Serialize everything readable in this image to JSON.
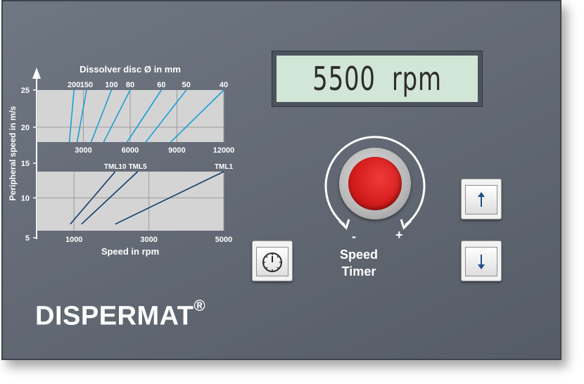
{
  "display": {
    "value": "5500",
    "unit": "rpm"
  },
  "knob": {
    "label_line1": "Speed",
    "label_line2": "Timer",
    "minus": "-",
    "plus": "+"
  },
  "buttons": {
    "timer_icon": "stopwatch-icon",
    "up_icon": "arrow-up-icon",
    "down_icon": "arrow-down-icon"
  },
  "brand": {
    "name": "DISPERMAT",
    "mark": "®"
  },
  "colors": {
    "panel": "#656c77",
    "lcd": "#d1e6d6",
    "knob_red": "#d51d1d",
    "chart_bg": "#d4d4d4",
    "upper_lines": "#1a9fd6",
    "lower_lines": "#123a68"
  },
  "chart_data": [
    {
      "type": "line",
      "title": "Dissolver disc Ø in mm",
      "ylabel": "Peripheral speed in m/s",
      "xlabel": "",
      "ylim": [
        18,
        25
      ],
      "xlim": [
        0,
        12000
      ],
      "x_ticks": [
        "3000",
        "6000",
        "9000",
        "12000"
      ],
      "y_ticks": [
        "25",
        "20",
        "15",
        "10",
        "5"
      ],
      "grid": true,
      "series": [
        {
          "name": "200",
          "x": [
            2100,
            2400
          ],
          "y": [
            18,
            25
          ]
        },
        {
          "name": "150",
          "x": [
            2600,
            3200
          ],
          "y": [
            18,
            25
          ]
        },
        {
          "name": "100",
          "x": [
            3500,
            4800
          ],
          "y": [
            18,
            25
          ]
        },
        {
          "name": "80",
          "x": [
            4300,
            6000
          ],
          "y": [
            18,
            25
          ]
        },
        {
          "name": "60",
          "x": [
            5800,
            8000
          ],
          "y": [
            18,
            25
          ]
        },
        {
          "name": "50",
          "x": [
            7000,
            9600
          ],
          "y": [
            18,
            25
          ]
        },
        {
          "name": "40",
          "x": [
            8600,
            12000
          ],
          "y": [
            18,
            25
          ]
        }
      ]
    },
    {
      "type": "line",
      "title": "",
      "xlabel": "Speed in rpm",
      "ylim": [
        5,
        14
      ],
      "xlim": [
        0,
        5000
      ],
      "x_ticks": [
        "1000",
        "3000",
        "5000"
      ],
      "grid": true,
      "series": [
        {
          "name": "TML10",
          "x": [
            900,
            2100
          ],
          "y": [
            6,
            14
          ]
        },
        {
          "name": "TML5",
          "x": [
            1200,
            2700
          ],
          "y": [
            6,
            14
          ]
        },
        {
          "name": "TML1",
          "x": [
            2100,
            5000
          ],
          "y": [
            6,
            14
          ]
        }
      ]
    }
  ]
}
